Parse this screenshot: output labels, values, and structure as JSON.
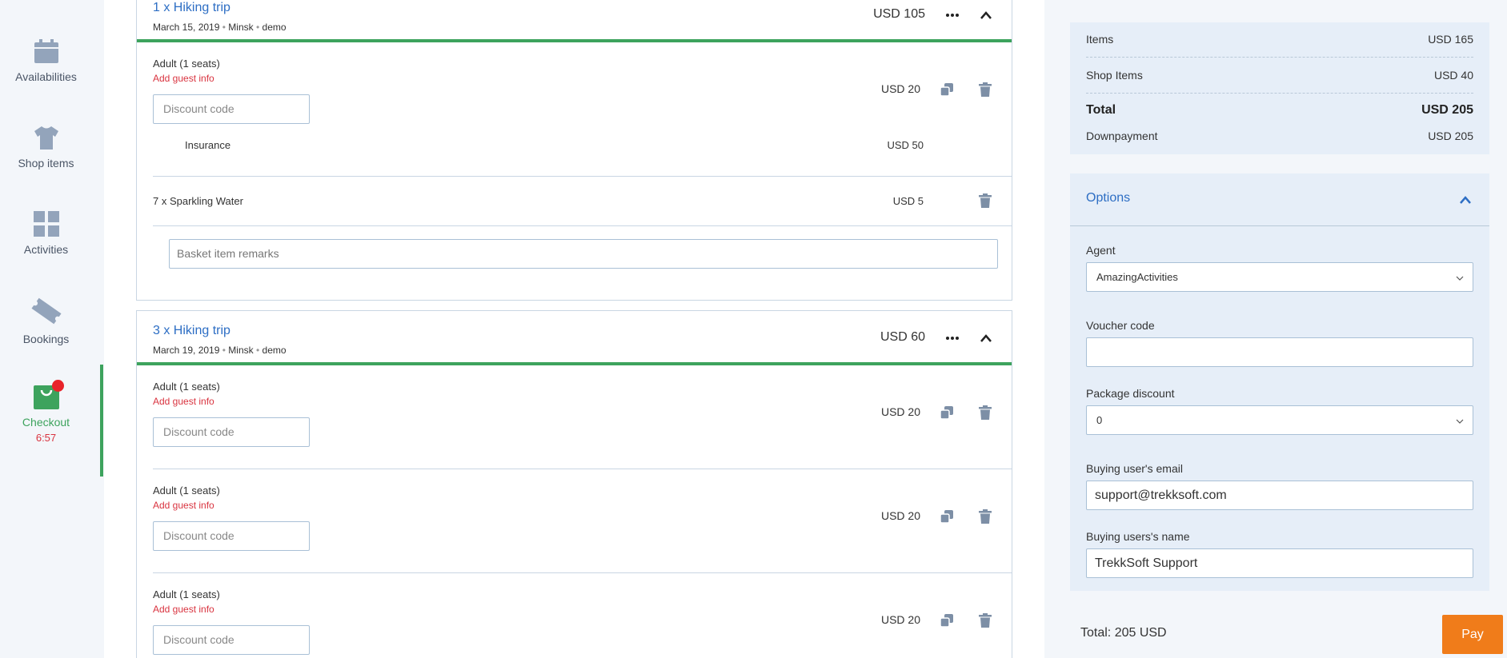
{
  "sidebar": {
    "items": [
      {
        "label": "Availabilities"
      },
      {
        "label": "Shop items"
      },
      {
        "label": "Activities"
      },
      {
        "label": "Bookings"
      },
      {
        "label": "Checkout",
        "timer": "6:57"
      }
    ]
  },
  "cards": [
    {
      "title": "1 x Hiking trip",
      "date": "March 15, 2019",
      "location": "Minsk",
      "tag": "demo",
      "price": "USD 105",
      "rows": [
        {
          "label": "Adult (1 seats)",
          "guest_link": "Add guest info",
          "discount_placeholder": "Discount code",
          "price": "USD 20",
          "sub_label": "Insurance",
          "sub_price": "USD 50"
        },
        {
          "label": "7 x Sparkling Water",
          "price": "USD 5"
        }
      ],
      "remarks_placeholder": "Basket item remarks"
    },
    {
      "title": "3 x Hiking trip",
      "date": "March 19, 2019",
      "location": "Minsk",
      "tag": "demo",
      "price": "USD 60",
      "rows": [
        {
          "label": "Adult (1 seats)",
          "guest_link": "Add guest info",
          "discount_placeholder": "Discount code",
          "price": "USD 20"
        },
        {
          "label": "Adult (1 seats)",
          "guest_link": "Add guest info",
          "discount_placeholder": "Discount code",
          "price": "USD 20"
        },
        {
          "label": "Adult (1 seats)",
          "guest_link": "Add guest info",
          "discount_placeholder": "Discount code",
          "price": "USD 20"
        }
      ]
    }
  ],
  "summary": {
    "items_label": "Items",
    "items_value": "USD 165",
    "shop_label": "Shop Items",
    "shop_value": "USD 40",
    "total_label": "Total",
    "total_value": "USD 205",
    "down_label": "Downpayment",
    "down_value": "USD 205"
  },
  "options": {
    "title": "Options",
    "agent_label": "Agent",
    "agent_value": "AmazingActivities",
    "voucher_label": "Voucher code",
    "voucher_value": "",
    "package_label": "Package discount",
    "package_value": "0",
    "email_label": "Buying user's email",
    "email_value": "support@trekksoft.com",
    "name_label": "Buying users's name",
    "name_value": "TrekkSoft Support"
  },
  "footer": {
    "total": "Total: 205 USD",
    "pay_label": "Pay"
  },
  "colors": {
    "accent": "#3da35d",
    "link": "#2d6ec4",
    "danger": "#d9333f",
    "pay": "#f07c1a"
  }
}
